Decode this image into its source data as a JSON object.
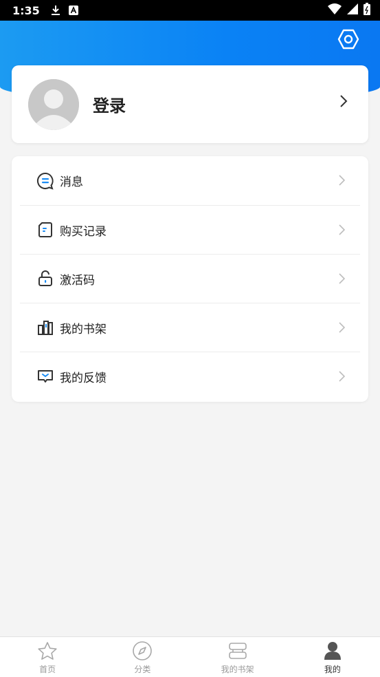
{
  "status_bar": {
    "time": "1:35"
  },
  "header": {
    "settings_icon": "settings-hexagon-icon",
    "gradient_start": "#1c9bf2",
    "gradient_end": "#0a78f2"
  },
  "login": {
    "label": "登录"
  },
  "menu": {
    "items": [
      {
        "label": "消息",
        "icon": "message-bubble-icon"
      },
      {
        "label": "购买记录",
        "icon": "purchase-record-icon"
      },
      {
        "label": "激活码",
        "icon": "unlock-icon"
      },
      {
        "label": "我的书架",
        "icon": "bookshelf-icon"
      },
      {
        "label": "我的反馈",
        "icon": "feedback-icon"
      }
    ]
  },
  "bottom_nav": {
    "items": [
      {
        "label": "首页",
        "icon": "star-icon",
        "active": false
      },
      {
        "label": "分类",
        "icon": "compass-icon",
        "active": false
      },
      {
        "label": "我的书架",
        "icon": "bookshelf-stack-icon",
        "active": false
      },
      {
        "label": "我的",
        "icon": "person-icon",
        "active": true
      }
    ]
  }
}
